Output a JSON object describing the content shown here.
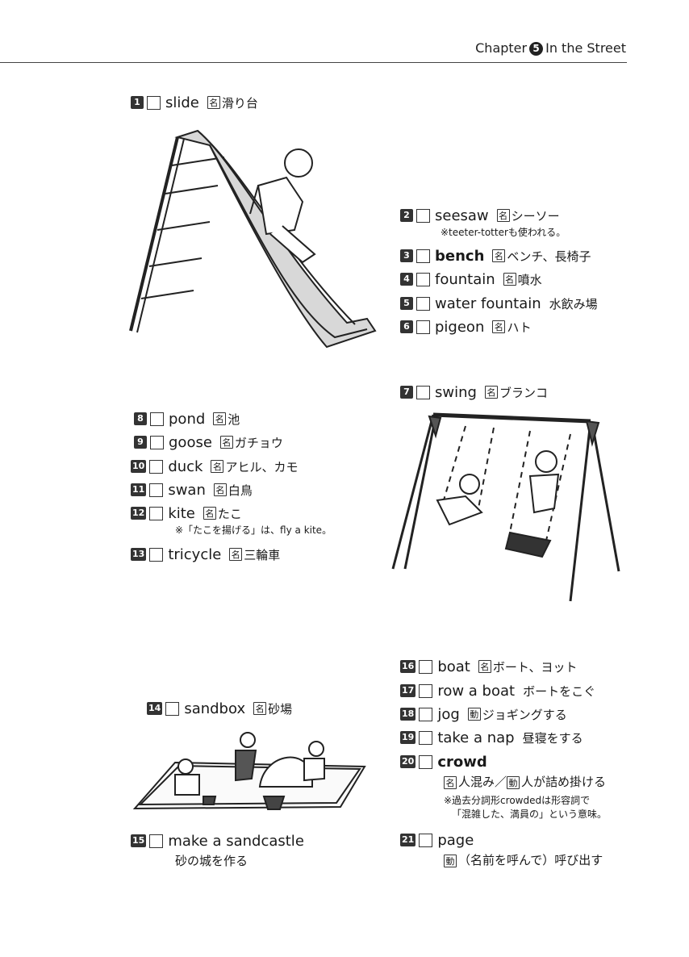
{
  "header": {
    "chapter_label": "Chapter",
    "chapter_number": "5",
    "chapter_title": "In the Street"
  },
  "pos_labels": {
    "noun": "名",
    "verb": "動"
  },
  "entries": {
    "e1": {
      "num": "1",
      "word": "slide",
      "meaning": "滑り台"
    },
    "e2": {
      "num": "2",
      "word": "seesaw",
      "meaning": "シーソー",
      "note": "※teeter-totterも使われる。"
    },
    "e3": {
      "num": "3",
      "word": "bench",
      "meaning": "ベンチ、長椅子"
    },
    "e4": {
      "num": "4",
      "word": "fountain",
      "meaning": "噴水"
    },
    "e5": {
      "num": "5",
      "word": "water fountain",
      "meaning": "水飲み場"
    },
    "e6": {
      "num": "6",
      "word": "pigeon",
      "meaning": "ハト"
    },
    "e7": {
      "num": "7",
      "word": "swing",
      "meaning": "ブランコ"
    },
    "e8": {
      "num": "8",
      "word": "pond",
      "meaning": "池"
    },
    "e9": {
      "num": "9",
      "word": "goose",
      "meaning": "ガチョウ"
    },
    "e10": {
      "num": "10",
      "word": "duck",
      "meaning": "アヒル、カモ"
    },
    "e11": {
      "num": "11",
      "word": "swan",
      "meaning": "白鳥"
    },
    "e12": {
      "num": "12",
      "word": "kite",
      "meaning": "たこ",
      "note": "※「たこを揚げる」は、fly a kite。"
    },
    "e13": {
      "num": "13",
      "word": "tricycle",
      "meaning": "三輪車"
    },
    "e14": {
      "num": "14",
      "word": "sandbox",
      "meaning": "砂場"
    },
    "e15": {
      "num": "15",
      "word": "make a sandcastle",
      "meaning": "砂の城を作る"
    },
    "e16": {
      "num": "16",
      "word": "boat",
      "meaning": "ボート、ヨット"
    },
    "e17": {
      "num": "17",
      "word": "row a boat",
      "meaning": "ボートをこぐ"
    },
    "e18": {
      "num": "18",
      "word": "jog",
      "meaning": "ジョギングする"
    },
    "e19": {
      "num": "19",
      "word": "take a nap",
      "meaning": "昼寝をする"
    },
    "e20": {
      "num": "20",
      "word": "crowd",
      "meaning_noun": "人混み／",
      "meaning_verb": "人が詰め掛ける",
      "note_line1": "※過去分詞形crowdedは形容詞で",
      "note_line2": "「混雑した、満員の」という意味。"
    },
    "e21": {
      "num": "21",
      "word": "page",
      "meaning": "（名前を呼んで）呼び出す"
    }
  }
}
